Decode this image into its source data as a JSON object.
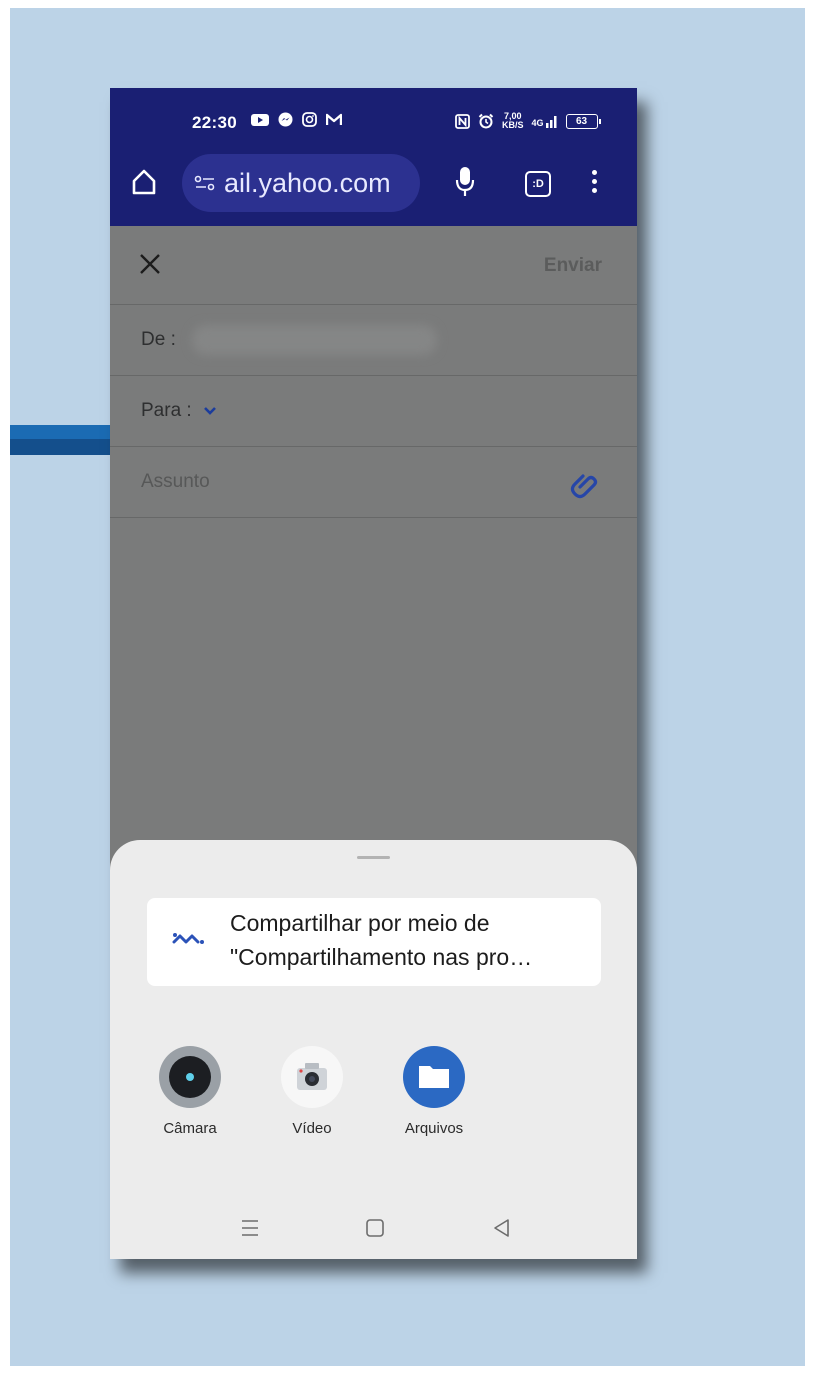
{
  "status_bar": {
    "time": "22:30",
    "icons_left": [
      "youtube-icon",
      "messenger-icon",
      "instagram-icon",
      "gmail-icon"
    ],
    "net_speed_value": "7,00",
    "net_speed_unit": "KB/S",
    "network": "4G",
    "battery": "63"
  },
  "browser": {
    "url": "ail.yahoo.com",
    "tab_badge": ":D"
  },
  "compose": {
    "send_label": "Enviar",
    "from_label": "De :",
    "to_label": "Para :",
    "subject_placeholder": "Assunto"
  },
  "share_sheet": {
    "share_line1": "Compartilhar por meio de",
    "share_line2": "\"Compartilhamento nas pro…",
    "apps": [
      {
        "label": "Câmara",
        "icon": "camera-icon"
      },
      {
        "label": "Vídeo",
        "icon": "video-camera-icon"
      },
      {
        "label": "Arquivos",
        "icon": "folder-icon"
      }
    ]
  },
  "colors": {
    "browser_bar": "#1a1f73",
    "background_panel": "#bcd3e7",
    "accent_blue": "#2b69c3"
  }
}
